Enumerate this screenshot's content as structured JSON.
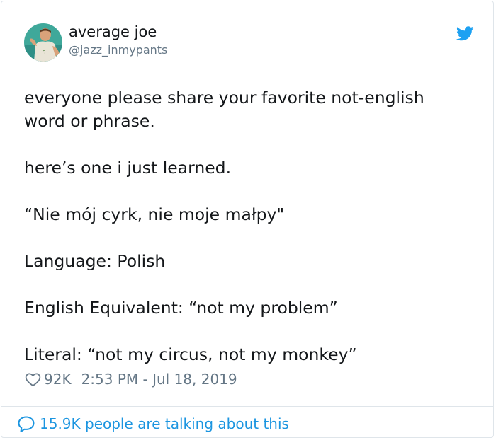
{
  "user": {
    "display_name": "average joe",
    "handle": "@jazz_inmypants"
  },
  "icons": {
    "brand": "twitter-bird-icon",
    "like": "heart-icon",
    "reply": "speech-bubble-icon",
    "accent_color": "#1da1f2",
    "link_color": "#1b95e0",
    "muted_color": "#657786"
  },
  "tweet": {
    "paragraphs": [
      "everyone please share your favorite not-english",
      "word or phrase.",
      "here’s one i just learned.",
      "“Nie mój cyrk, nie moje małpy\"",
      "Language: Polish",
      "English Equivalent: “not my problem”",
      "Literal: “not my circus, not my monkey”"
    ]
  },
  "meta": {
    "likes": "92K",
    "timestamp": "2:53 PM - Jul 18, 2019"
  },
  "footer": {
    "talking_text": "15.9K people are talking about this"
  }
}
